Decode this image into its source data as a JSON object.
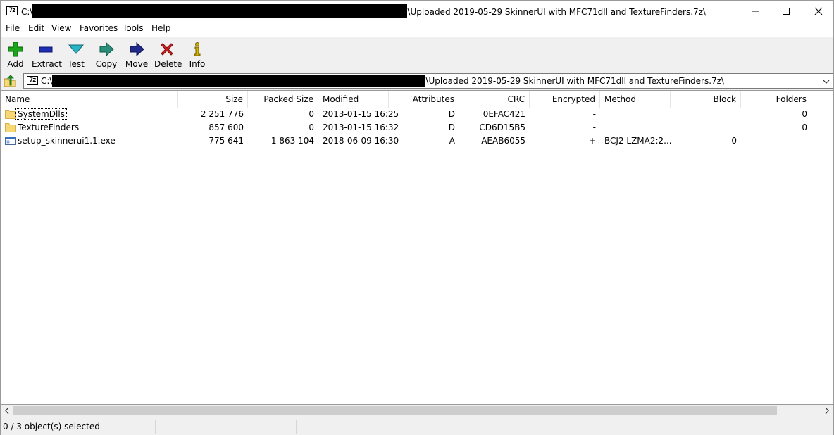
{
  "window": {
    "app_icon_text": "7z",
    "title_prefix": "C:\\",
    "title_suffix": "\\Uploaded 2019-05-29 SkinnerUI with MFC71dll and TextureFinders.7z\\"
  },
  "menu": [
    "File",
    "Edit",
    "View",
    "Favorites",
    "Tools",
    "Help"
  ],
  "toolbar": {
    "add": "Add",
    "extract": "Extract",
    "test": "Test",
    "copy": "Copy",
    "move": "Move",
    "delete": "Delete",
    "info": "Info"
  },
  "address": {
    "icon_text": "7z",
    "prefix": "C:\\",
    "suffix": "\\Uploaded 2019-05-29 SkinnerUI with MFC71dll and TextureFinders.7z\\"
  },
  "columns": [
    "Name",
    "Size",
    "Packed Size",
    "Modified",
    "Attributes",
    "CRC",
    "Encrypted",
    "Method",
    "Block",
    "Folders"
  ],
  "rows": [
    {
      "name": "SystemDlls",
      "type": "folder",
      "size": "2 251 776",
      "packed": "0",
      "modified": "2013-01-15 16:25",
      "attributes": "D",
      "crc": "0EFAC421",
      "encrypted": "-",
      "method": "",
      "block": "",
      "folders": "0"
    },
    {
      "name": "TextureFinders",
      "type": "folder",
      "size": "857 600",
      "packed": "0",
      "modified": "2013-01-15 16:32",
      "attributes": "D",
      "crc": "CD6D15B5",
      "encrypted": "-",
      "method": "",
      "block": "",
      "folders": "0"
    },
    {
      "name": "setup_skinnerui1.1.exe",
      "type": "file",
      "size": "775 641",
      "packed": "1 863 104",
      "modified": "2018-06-09 16:30",
      "attributes": "A",
      "crc": "AEAB6055",
      "encrypted": "+",
      "method": "BCJ2 LZMA2:2...",
      "block": "0",
      "folders": ""
    }
  ],
  "status": {
    "selection": "0 / 3 object(s) selected"
  },
  "colors": {
    "folder": "#f8d775",
    "add": "#1aa51a",
    "extract": "#1f2fb5",
    "test": "#2bb3c8",
    "copy": "#2a8f7a",
    "move": "#1f2a8c",
    "delete": "#d42020",
    "info": "#d6b400"
  }
}
